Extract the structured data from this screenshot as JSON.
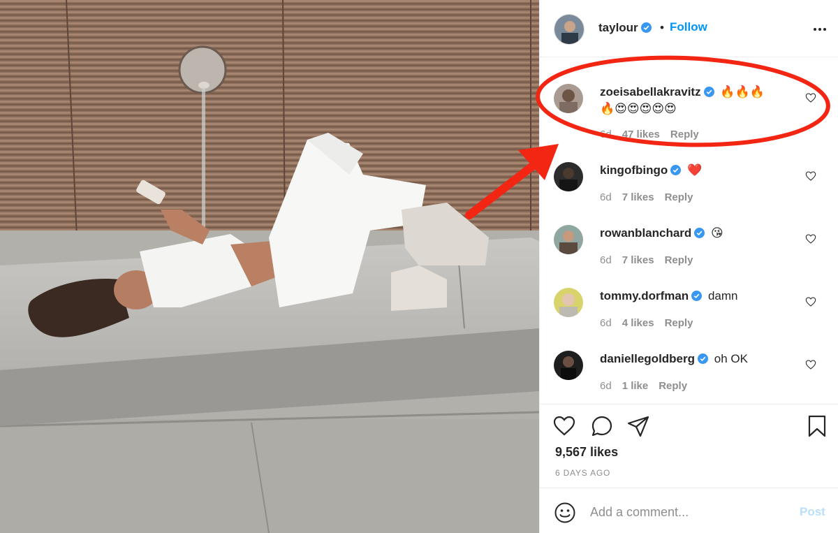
{
  "post": {
    "username": "taylour",
    "separator": "•",
    "follow_label": "Follow",
    "more_icon": "more-dots-icon"
  },
  "comments": [
    {
      "username": "zoeisabellakravitz",
      "verified": true,
      "text": "",
      "emoji_line1": "🔥🔥🔥",
      "emoji_line2": "🔥😍😍😍😍😍",
      "time": "6d",
      "likes": "47 likes",
      "reply": "Reply"
    },
    {
      "username": "kingofbingo",
      "verified": true,
      "text": "",
      "emoji_line1": "❤️",
      "emoji_line2": "",
      "time": "6d",
      "likes": "7 likes",
      "reply": "Reply"
    },
    {
      "username": "rowanblanchard",
      "verified": true,
      "text": "",
      "emoji_line1": "😘",
      "emoji_line2": "",
      "time": "6d",
      "likes": "7 likes",
      "reply": "Reply"
    },
    {
      "username": "tommy.dorfman",
      "verified": true,
      "text": "damn",
      "emoji_line1": "",
      "emoji_line2": "",
      "time": "6d",
      "likes": "4 likes",
      "reply": "Reply"
    },
    {
      "username": "daniellegoldberg",
      "verified": true,
      "text": "oh OK",
      "emoji_line1": "",
      "emoji_line2": "",
      "time": "6d",
      "likes": "1 like",
      "reply": "Reply"
    }
  ],
  "actions": {
    "likes": "9,567 likes",
    "timestamp": "6 DAYS AGO"
  },
  "add_comment": {
    "placeholder": "Add a comment...",
    "post_label": "Post"
  },
  "colors": {
    "link_blue": "#0095f6",
    "verified_blue": "#3897f0",
    "annotation_red": "#f22613",
    "muted": "#8e8e8e"
  }
}
